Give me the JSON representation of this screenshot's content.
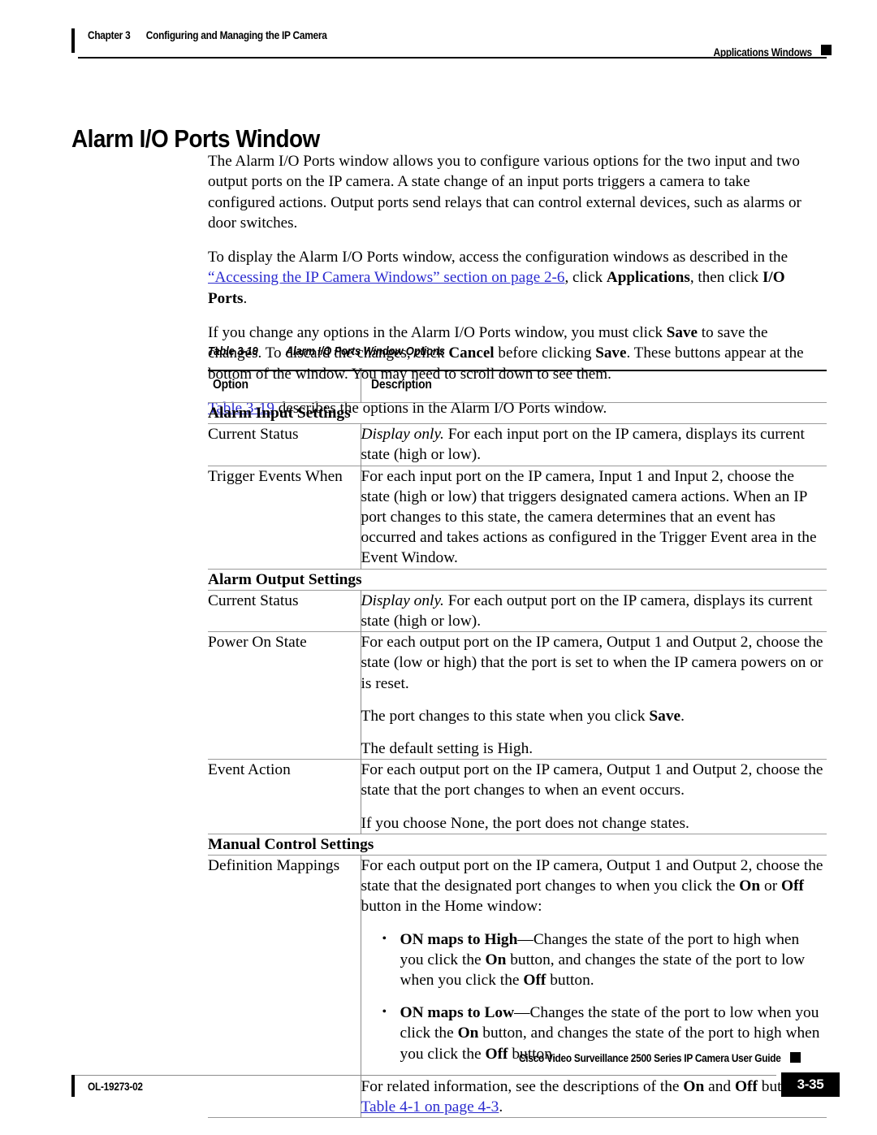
{
  "header": {
    "chapter_number": "Chapter 3",
    "chapter_title": "Configuring and Managing the IP Camera",
    "right_label": "Applications Windows"
  },
  "title": "Alarm I/O Ports Window",
  "paragraphs": {
    "p1": "The Alarm I/O Ports window allows you to configure various options for the two input and two output ports on the IP camera. A state change of an input ports triggers a camera to take configured actions. Output ports send relays that can control external devices, such as alarms or door switches.",
    "p2_a": "To display the Alarm I/O Ports window, access the configuration windows as described in the ",
    "p2_link": "“Accessing the IP Camera Windows” section on page 2-6",
    "p2_b": ", click ",
    "p2_bold1": "Applications",
    "p2_c": ", then click ",
    "p2_bold2": "I/O Ports",
    "p2_d": ".",
    "p3_a": "If you change any options in the Alarm I/O Ports window, you must click ",
    "p3_bold1": "Save",
    "p3_b": " to save the changes. To discard the changes, click ",
    "p3_bold2": "Cancel",
    "p3_c": " before clicking ",
    "p3_bold3": "Save",
    "p3_d": ". These buttons appear at the bottom of the window. You may need to scroll down to see them.",
    "p4_link": "Table 3-19",
    "p4_rest": " describes the options in the Alarm I/O Ports window."
  },
  "table": {
    "caption_label": "Table 3-19",
    "caption_title": "Alarm I/O Ports Window Options",
    "columns": [
      "Option",
      "Description"
    ],
    "rows": [
      {
        "type": "group",
        "label": "Alarm Input Settings"
      },
      {
        "type": "data",
        "option": "Current Status",
        "blocks": [
          {
            "kind": "para",
            "italic_lead": "Display only.",
            "text": " For each input port on the IP camera, displays its current state (high or low)."
          }
        ]
      },
      {
        "type": "data",
        "option": "Trigger Events When",
        "blocks": [
          {
            "kind": "para",
            "text": "For each input port on the IP camera, Input 1 and Input 2, choose the state (high or low) that triggers designated camera actions. When an IP port changes to this state, the camera determines that an event has occurred and takes actions as configured in the Trigger Event area in the Event Window."
          }
        ]
      },
      {
        "type": "group",
        "label": "Alarm Output Settings"
      },
      {
        "type": "data",
        "option": "Current Status",
        "blocks": [
          {
            "kind": "para",
            "italic_lead": "Display only.",
            "text": " For each output port on the IP camera, displays its current state (high or low)."
          }
        ]
      },
      {
        "type": "data",
        "option": "Power On State",
        "blocks": [
          {
            "kind": "para",
            "text": "For each output port on the IP camera, Output 1 and Output 2, choose the state (low or high) that the port is set to when the IP camera powers on or is reset."
          },
          {
            "kind": "para_bold_mid",
            "pre": "The port changes to this state when you click ",
            "bold": "Save",
            "post": "."
          },
          {
            "kind": "para",
            "text": "The default setting is High."
          }
        ]
      },
      {
        "type": "data",
        "option": "Event Action",
        "blocks": [
          {
            "kind": "para",
            "text": "For each output port on the IP camera, Output 1 and Output 2, choose the state that the port changes to when an event occurs."
          },
          {
            "kind": "para",
            "text": "If you choose None, the port does not change states."
          }
        ]
      },
      {
        "type": "group",
        "label": "Manual Control Settings"
      },
      {
        "type": "data",
        "option": "Definition Mappings",
        "blocks": [
          {
            "kind": "intro",
            "a": "For each output port on the IP camera, Output 1 and Output 2, choose the state that the designated port changes to when you click the ",
            "b1": "On",
            "b": " or ",
            "b2": "Off",
            "c": " button in the Home window:"
          },
          {
            "kind": "bullets",
            "items": [
              {
                "lead": "ON maps to High",
                "a": "—Changes the state of the port to high when you click the ",
                "b1": "On",
                "b": " button, and changes the state of the port to low when you click the ",
                "b2": "Off",
                "c": " button."
              },
              {
                "lead": "ON maps to Low",
                "a": "—Changes the state of the port to low when you click the ",
                "b1": "On",
                "b": " button, and changes the state of the port to high when you click the ",
                "b2": "Off",
                "c": " button."
              }
            ]
          },
          {
            "kind": "related",
            "a": "For related information, see the descriptions of the ",
            "b1": "On",
            "b": " and ",
            "b2": "Off",
            "c": " button in ",
            "link": "Table 4-1 on page 4-3",
            "d": "."
          }
        ]
      }
    ]
  },
  "footer": {
    "guide_title": "Cisco Video Surveillance 2500 Series IP Camera User Guide",
    "doc_id": "OL-19273-02",
    "page_number": "3-35"
  },
  "colors": {
    "link": "#2b2bcf",
    "text": "#000000",
    "rule_light": "#9a9a9a",
    "rule_heavy": "#000000"
  }
}
